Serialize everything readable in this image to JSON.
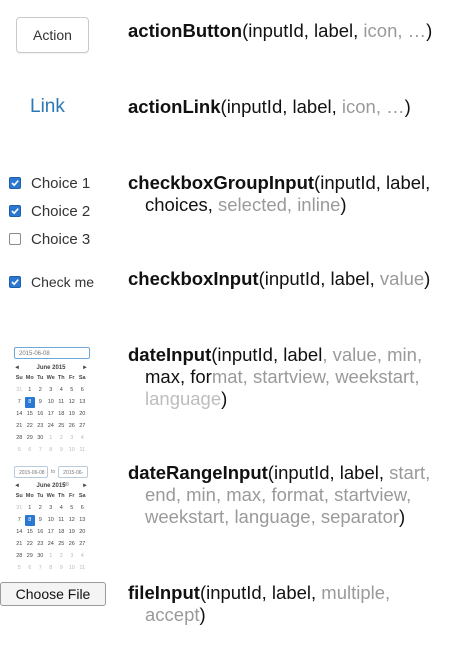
{
  "widgets": {
    "action_button_label": "Action",
    "action_link_label": "Link",
    "checkbox_group": [
      {
        "label": "Choice 1",
        "checked": true
      },
      {
        "label": "Choice 2",
        "checked": true
      },
      {
        "label": "Choice 3",
        "checked": false
      }
    ],
    "checkbox_single": {
      "label": "Check me",
      "checked": true
    },
    "date_value": "2015-06-08",
    "date_range_start": "2015-06-08",
    "date_range_sep": "to",
    "date_range_end": "2015-06-08",
    "calendar": {
      "month_label": "June 2015",
      "prev": "◄",
      "next": "►",
      "dow": [
        "Su",
        "Mo",
        "Tu",
        "We",
        "Th",
        "Fr",
        "Sa"
      ],
      "weeks": [
        [
          "31",
          "1",
          "2",
          "3",
          "4",
          "5",
          "6"
        ],
        [
          "7",
          "8",
          "9",
          "10",
          "11",
          "12",
          "13"
        ],
        [
          "14",
          "15",
          "16",
          "17",
          "18",
          "19",
          "20"
        ],
        [
          "21",
          "22",
          "23",
          "24",
          "25",
          "26",
          "27"
        ],
        [
          "28",
          "29",
          "30",
          "1",
          "2",
          "3",
          "4"
        ],
        [
          "5",
          "6",
          "7",
          "8",
          "9",
          "10",
          "11"
        ]
      ],
      "selected": "8"
    },
    "file_button_label": "Choose File"
  },
  "signatures": {
    "action_button": {
      "fn": "actionButton",
      "open": "(",
      "req": "inputId, label,",
      "opt": " icon, …",
      "close": ")"
    },
    "action_link": {
      "fn": "actionLink",
      "open": "(",
      "req": "inputId, label,",
      "opt": " icon, …",
      "close": ")"
    },
    "checkbox_group": {
      "fn": "checkboxGroupInput",
      "open": "(",
      "req": "inputId, label,",
      "req2": "choices,",
      "opt": " selected, inline",
      "close": ")"
    },
    "checkbox_input": {
      "fn": "checkboxInput",
      "open": "(",
      "req": "inputId, label,",
      "opt": " value",
      "close": ")"
    },
    "date_input": {
      "fn": "dateInput",
      "open": "(",
      "req": "inputId, label",
      "opt1": ", value, min,",
      "line2_req": "max, for",
      "line2_opt": "mat, startview, weekstart,",
      "line3_opt": "language",
      "close": ")"
    },
    "date_range": {
      "fn": "dateRangeInput",
      "open": "(",
      "req": "inputId, label,",
      "opt": " start,",
      "line2": "end, min, max, format, startview,",
      "line3": "weekstart, language, separator",
      "close": ")"
    },
    "file_input": {
      "fn": "fileInput",
      "open": "(",
      "req": "inputId, label,",
      "opt": " multiple,",
      "line2_opt": "accept",
      "close": ")"
    }
  },
  "colors": {
    "link": "#2a78b5",
    "accent": "#2a78d2",
    "optional_arg": "#9a9a9a"
  }
}
